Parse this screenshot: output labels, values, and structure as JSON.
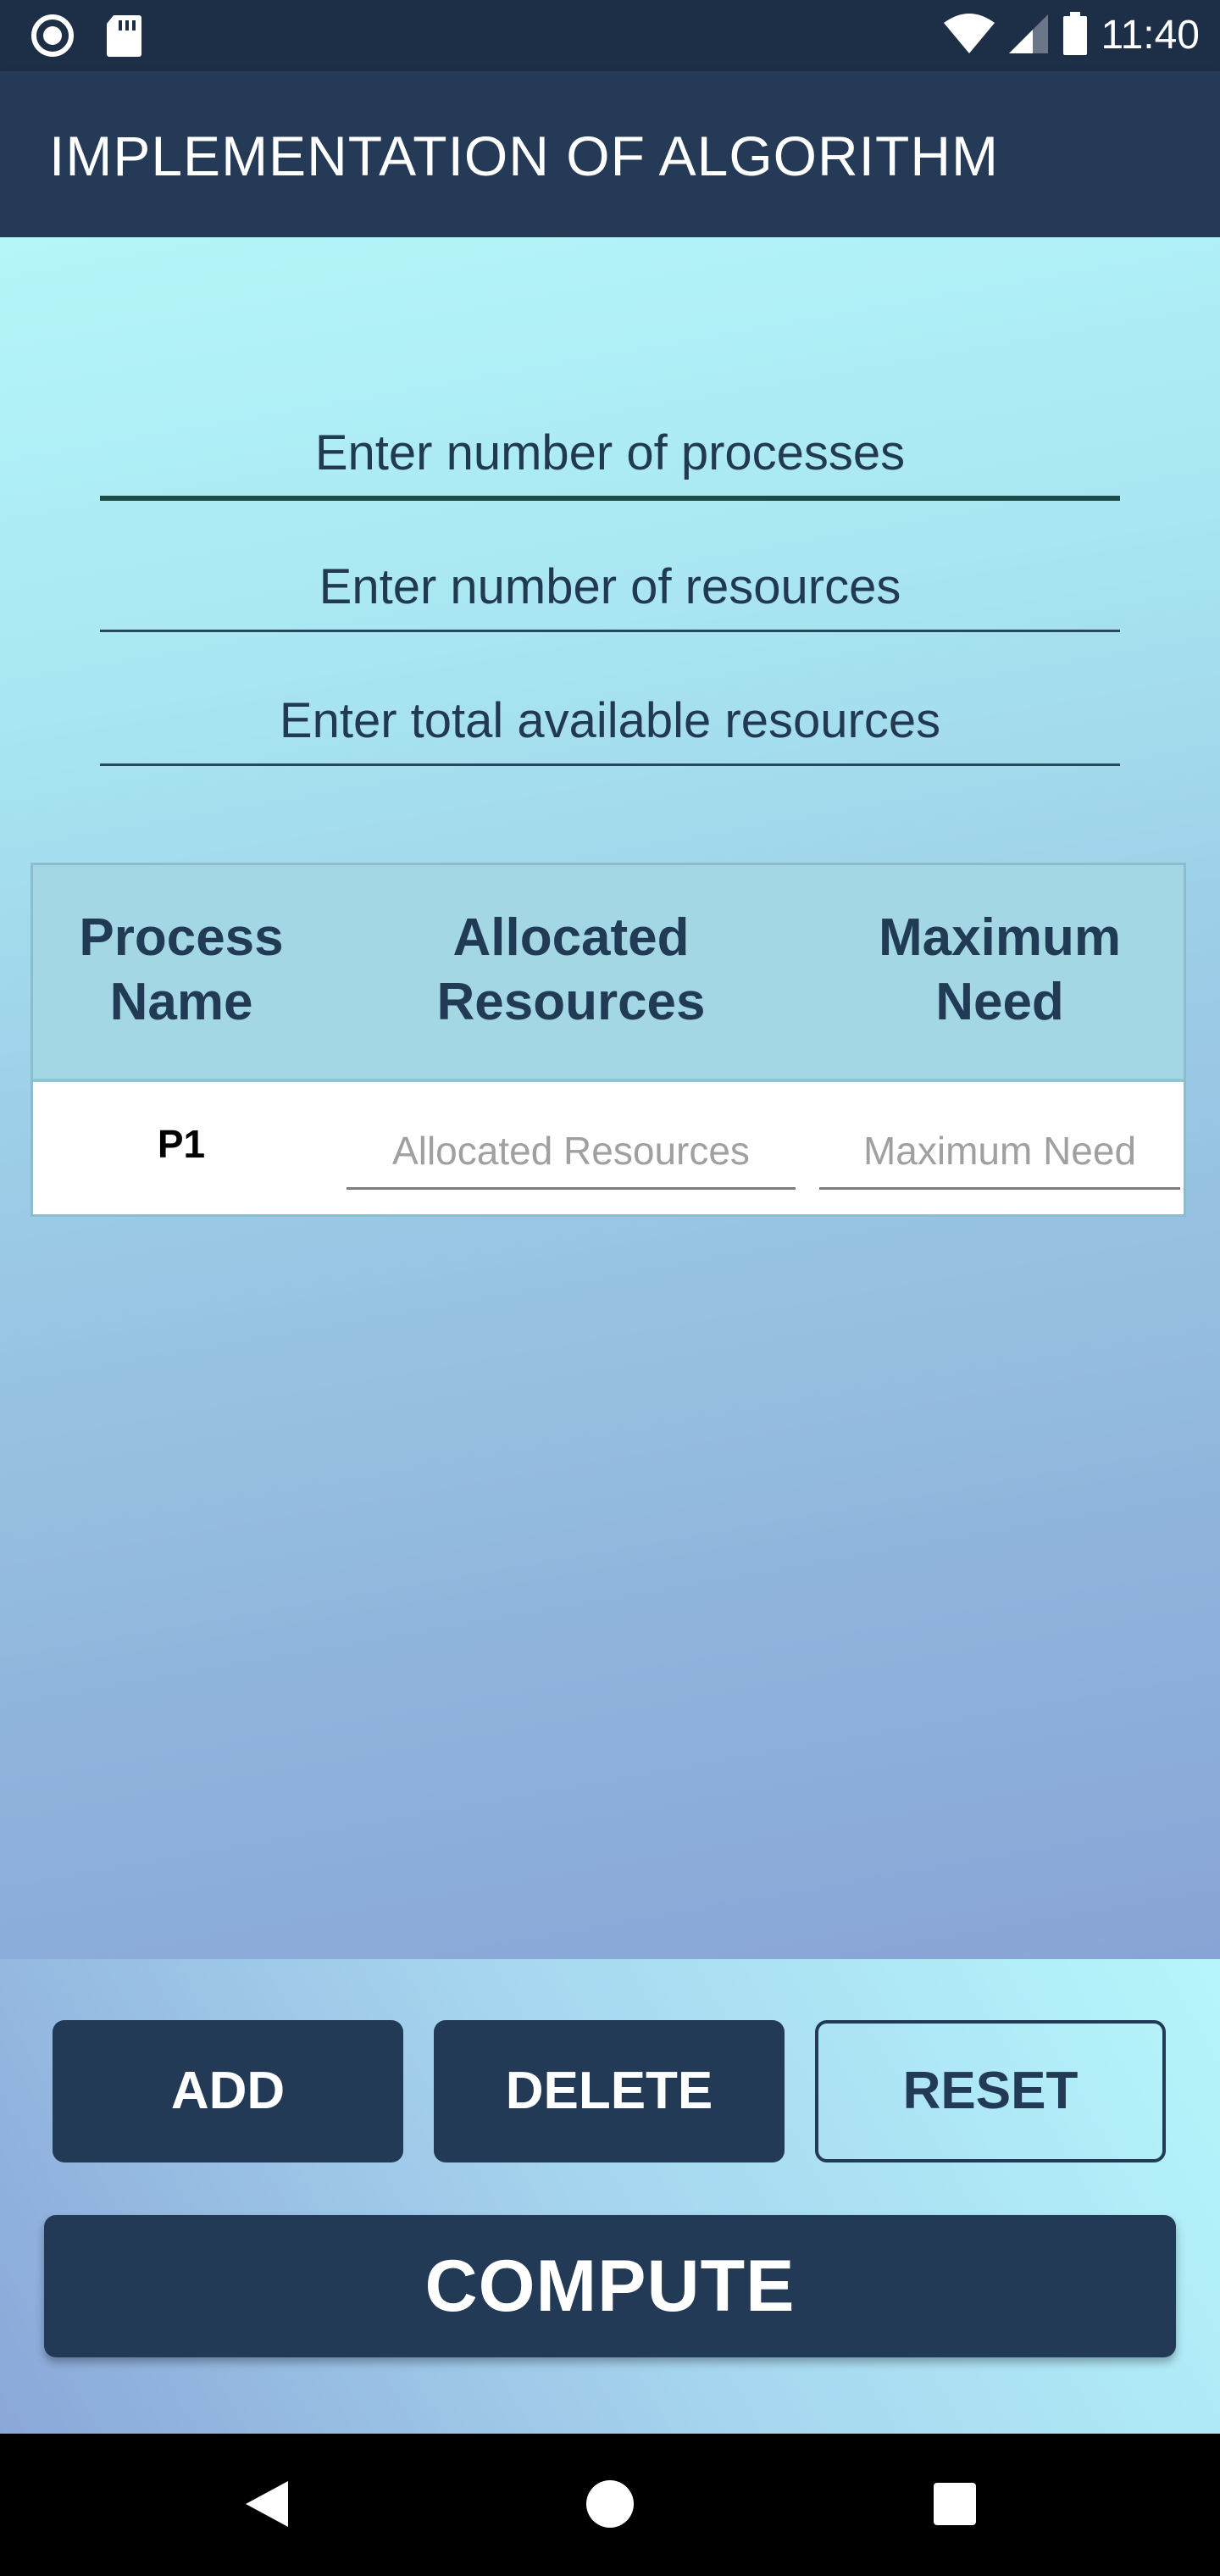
{
  "status_bar": {
    "time": "11:40"
  },
  "app_bar": {
    "title": "IMPLEMENTATION OF ALGORITHM"
  },
  "form": {
    "processes_placeholder": "Enter number of processes",
    "resources_placeholder": "Enter number of resources",
    "available_placeholder": "Enter total available resources"
  },
  "table": {
    "headers": [
      "Process\nName",
      "Allocated\nResources",
      "Maximum\nNeed"
    ],
    "rows": [
      {
        "name": "P1",
        "allocated_placeholder": "Allocated Resources",
        "max_placeholder": "Maximum Need"
      }
    ]
  },
  "buttons": {
    "add": "ADD",
    "delete": "DELETE",
    "reset": "RESET",
    "compute": "COMPUTE"
  },
  "icons": [
    "record-icon",
    "sd-card-icon",
    "wifi-icon",
    "signal-icon",
    "battery-icon",
    "back-icon",
    "home-icon",
    "recents-icon"
  ],
  "colors": {
    "primary": "#243a56",
    "accent_bg": "#b4f6fa"
  }
}
